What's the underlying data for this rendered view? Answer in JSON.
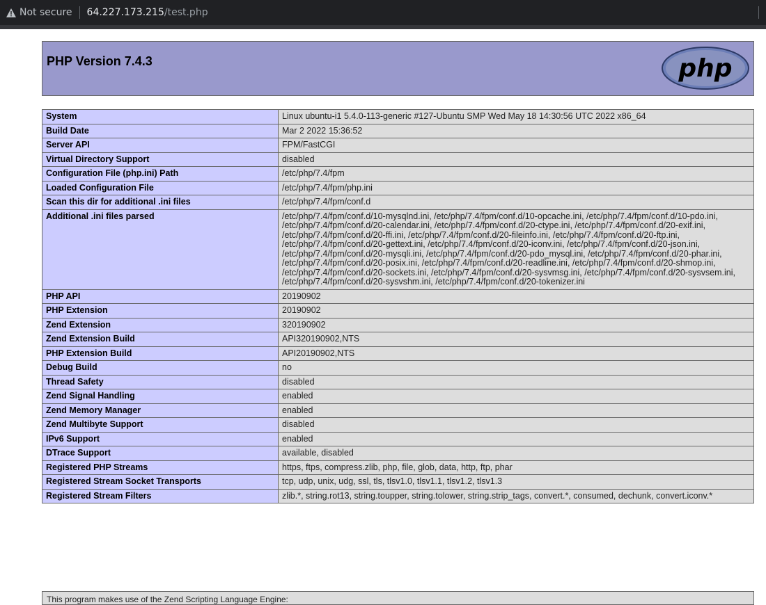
{
  "browser": {
    "security_label": "Not secure",
    "host": "64.227.173.215",
    "path": "/test.php"
  },
  "header": {
    "title": "PHP Version 7.4.3",
    "logo_text": "php"
  },
  "rows": [
    {
      "label": "System",
      "value": "Linux ubuntu-i1 5.4.0-113-generic #127-Ubuntu SMP Wed May 18 14:30:56 UTC 2022 x86_64"
    },
    {
      "label": "Build Date",
      "value": "Mar 2 2022 15:36:52"
    },
    {
      "label": "Server API",
      "value": "FPM/FastCGI"
    },
    {
      "label": "Virtual Directory Support",
      "value": "disabled"
    },
    {
      "label": "Configuration File (php.ini) Path",
      "value": "/etc/php/7.4/fpm"
    },
    {
      "label": "Loaded Configuration File",
      "value": "/etc/php/7.4/fpm/php.ini"
    },
    {
      "label": "Scan this dir for additional .ini files",
      "value": "/etc/php/7.4/fpm/conf.d"
    },
    {
      "label": "Additional .ini files parsed",
      "value": "/etc/php/7.4/fpm/conf.d/10-mysqlnd.ini, /etc/php/7.4/fpm/conf.d/10-opcache.ini, /etc/php/7.4/fpm/conf.d/10-pdo.ini, /etc/php/7.4/fpm/conf.d/20-calendar.ini, /etc/php/7.4/fpm/conf.d/20-ctype.ini, /etc/php/7.4/fpm/conf.d/20-exif.ini, /etc/php/7.4/fpm/conf.d/20-ffi.ini, /etc/php/7.4/fpm/conf.d/20-fileinfo.ini, /etc/php/7.4/fpm/conf.d/20-ftp.ini, /etc/php/7.4/fpm/conf.d/20-gettext.ini, /etc/php/7.4/fpm/conf.d/20-iconv.ini, /etc/php/7.4/fpm/conf.d/20-json.ini, /etc/php/7.4/fpm/conf.d/20-mysqli.ini, /etc/php/7.4/fpm/conf.d/20-pdo_mysql.ini, /etc/php/7.4/fpm/conf.d/20-phar.ini, /etc/php/7.4/fpm/conf.d/20-posix.ini, /etc/php/7.4/fpm/conf.d/20-readline.ini, /etc/php/7.4/fpm/conf.d/20-shmop.ini, /etc/php/7.4/fpm/conf.d/20-sockets.ini, /etc/php/7.4/fpm/conf.d/20-sysvmsg.ini, /etc/php/7.4/fpm/conf.d/20-sysvsem.ini, /etc/php/7.4/fpm/conf.d/20-sysvshm.ini, /etc/php/7.4/fpm/conf.d/20-tokenizer.ini"
    },
    {
      "label": "PHP API",
      "value": "20190902"
    },
    {
      "label": "PHP Extension",
      "value": "20190902"
    },
    {
      "label": "Zend Extension",
      "value": "320190902"
    },
    {
      "label": "Zend Extension Build",
      "value": "API320190902,NTS"
    },
    {
      "label": "PHP Extension Build",
      "value": "API20190902,NTS"
    },
    {
      "label": "Debug Build",
      "value": "no"
    },
    {
      "label": "Thread Safety",
      "value": "disabled"
    },
    {
      "label": "Zend Signal Handling",
      "value": "enabled"
    },
    {
      "label": "Zend Memory Manager",
      "value": "enabled"
    },
    {
      "label": "Zend Multibyte Support",
      "value": "disabled"
    },
    {
      "label": "IPv6 Support",
      "value": "enabled"
    },
    {
      "label": "DTrace Support",
      "value": "available, disabled"
    },
    {
      "label": "Registered PHP Streams",
      "value": "https, ftps, compress.zlib, php, file, glob, data, http, ftp, phar"
    },
    {
      "label": "Registered Stream Socket Transports",
      "value": "tcp, udp, unix, udg, ssl, tls, tlsv1.0, tlsv1.1, tlsv1.2, tlsv1.3"
    },
    {
      "label": "Registered Stream Filters",
      "value": "zlib.*, string.rot13, string.toupper, string.tolower, string.strip_tags, convert.*, consumed, dechunk, convert.iconv.*"
    }
  ],
  "footer": {
    "text": "This program makes use of the Zend Scripting Language Engine:"
  },
  "colors": {
    "header_bg": "#9999cc",
    "label_bg": "#ccccff",
    "value_bg": "#dddddd",
    "addrbar_bg": "#202124"
  }
}
